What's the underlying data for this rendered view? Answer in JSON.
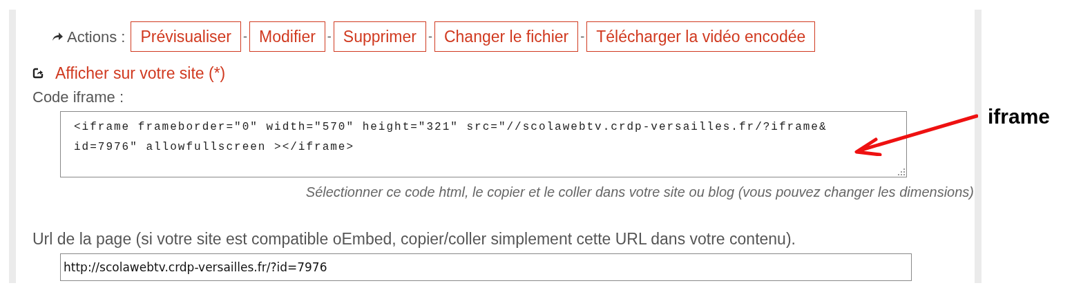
{
  "actions": {
    "label": "Actions :",
    "separator": "-",
    "buttons": [
      "Prévisualiser",
      "Modifier",
      "Supprimer",
      "Changer le fichier",
      "Télécharger la vidéo encodée"
    ]
  },
  "embed_link": "Afficher sur votre site (*)",
  "iframe_code": {
    "label": "Code iframe :",
    "value": "<iframe frameborder=\"0\" width=\"570\" height=\"321\" src=\"//scolawebtv.crdp-versailles.fr/?iframe&\nid=7976\" allowfullscreen ></iframe>",
    "hint": "Sélectionner ce code html, le copier et le coller dans votre site ou blog (vous pouvez changer les dimensions)"
  },
  "page_url": {
    "label": "Url de la page (si votre site est compatible oEmbed, copier/coller simplement cette URL dans votre contenu).",
    "value": "http://scolawebtv.crdp-versailles.fr/?id=7976"
  },
  "annotation": {
    "label": "iframe"
  }
}
